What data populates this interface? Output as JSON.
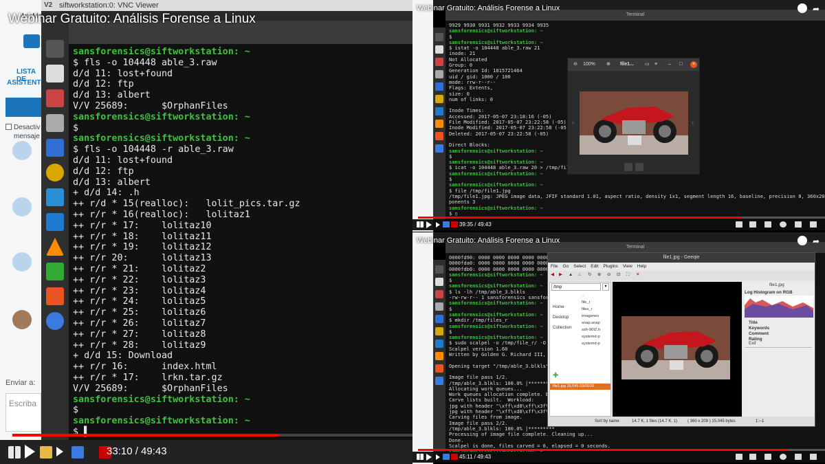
{
  "left": {
    "video_title": "Webinar Gratuito: Análisis Forense a Linux",
    "vnc_title": "siftworkstation:0: VNC Viewer",
    "bg_app": {
      "brand": "AnyMee",
      "list_label": "LISTA DE",
      "list_label2": "ASISTENTES",
      "checkbox_label": "Desactiv",
      "checkbox_label2": "mensaje",
      "send_to": "Enviar a:",
      "compose_placeholder": "Escriba"
    },
    "terminal_lines": [
      {
        "t": "p",
        "text": "sansforensics@siftworkstation: ~"
      },
      {
        "t": "o",
        "text": "$ fls -o 104448 able_3.raw"
      },
      {
        "t": "o",
        "text": "d/d 11: lost+found"
      },
      {
        "t": "o",
        "text": "d/d 12: ftp"
      },
      {
        "t": "o",
        "text": "d/d 13: albert"
      },
      {
        "t": "o",
        "text": "V/V 25689:      $OrphanFiles"
      },
      {
        "t": "p",
        "text": "sansforensics@siftworkstation: ~"
      },
      {
        "t": "o",
        "text": "$"
      },
      {
        "t": "p",
        "text": "sansforensics@siftworkstation: ~"
      },
      {
        "t": "o",
        "text": "$ fls -o 104448 -r able_3.raw"
      },
      {
        "t": "o",
        "text": "d/d 11: lost+found"
      },
      {
        "t": "o",
        "text": "d/d 12: ftp"
      },
      {
        "t": "o",
        "text": "d/d 13: albert"
      },
      {
        "t": "o",
        "text": "+ d/d 14: .h"
      },
      {
        "t": "o",
        "text": "++ r/d * 15(realloc):   lolit_pics.tar.gz"
      },
      {
        "t": "o",
        "text": "++ r/r * 16(realloc):   lolitaz1"
      },
      {
        "t": "o",
        "text": "++ r/r * 17:    lolitaz10"
      },
      {
        "t": "o",
        "text": "++ r/r * 18:    lolitaz11"
      },
      {
        "t": "o",
        "text": "++ r/r * 19:    lolitaz12"
      },
      {
        "t": "o",
        "text": "++ r/r 20:      lolitaz13"
      },
      {
        "t": "o",
        "text": "++ r/r * 21:    lolitaz2"
      },
      {
        "t": "o",
        "text": "++ r/r * 22:    lolitaz3"
      },
      {
        "t": "o",
        "text": "++ r/r * 23:    lolitaz4"
      },
      {
        "t": "o",
        "text": "++ r/r * 24:    lolitaz5"
      },
      {
        "t": "o",
        "text": "++ r/r * 25:    lolitaz6"
      },
      {
        "t": "o",
        "text": "++ r/r * 26:    lolitaz7"
      },
      {
        "t": "o",
        "text": "++ r/r * 27:    lolitaz8"
      },
      {
        "t": "o",
        "text": "++ r/r * 28:    lolitaz9"
      },
      {
        "t": "o",
        "text": "+ d/d 15: Download"
      },
      {
        "t": "o",
        "text": "++ r/r 16:      index.html"
      },
      {
        "t": "o",
        "text": "++ r/r * 17:    lrkn.tar.gz"
      },
      {
        "t": "o",
        "text": "V/V 25689:      $OrphanFiles"
      },
      {
        "t": "p",
        "text": "sansforensics@siftworkstation: ~"
      },
      {
        "t": "o",
        "text": "$"
      },
      {
        "t": "p",
        "text": "sansforensics@siftworkstation: ~"
      },
      {
        "t": "o",
        "text": "$ ▌"
      }
    ],
    "time": "33:10 / 49:43",
    "progress": 0.667
  },
  "top_right": {
    "video_title": "Webinar Gratuito: Análisis Forense a Linux",
    "window_title": "Terminal",
    "terminal_lines": [
      {
        "t": "o",
        "text": "9929 9930 9931 9932 9933 9934 9935"
      },
      {
        "t": "p",
        "text": "sansforensics@siftworkstation: ~"
      },
      {
        "t": "o",
        "text": "$"
      },
      {
        "t": "p",
        "text": "sansforensics@siftworkstation: ~"
      },
      {
        "t": "o",
        "text": "$ istat -o 104448 able_3.raw 21"
      },
      {
        "t": "o",
        "text": "inode: 21"
      },
      {
        "t": "o",
        "text": "Not Allocated"
      },
      {
        "t": "o",
        "text": "Group: 0"
      },
      {
        "t": "o",
        "text": "Generation Id: 1815721464"
      },
      {
        "t": "o",
        "text": "uid / gid: 1000 / 100"
      },
      {
        "t": "o",
        "text": "mode: rrw-r--r--"
      },
      {
        "t": "o",
        "text": "Flags: Extents,"
      },
      {
        "t": "o",
        "text": "size: 0"
      },
      {
        "t": "o",
        "text": "num of links: 0"
      },
      {
        "t": "o",
        "text": ""
      },
      {
        "t": "o",
        "text": "Inode Times:"
      },
      {
        "t": "o",
        "text": "Accessed: 2017-05-07 23:18:16 (-05)"
      },
      {
        "t": "o",
        "text": "File Modified: 2017-05-07 23:22:58 (-05)"
      },
      {
        "t": "o",
        "text": "Inode Modified: 2017-05-07 23:22:58 (-05)"
      },
      {
        "t": "o",
        "text": "Deleted: 2017-05-07 23:22:58 (-05)"
      },
      {
        "t": "o",
        "text": ""
      },
      {
        "t": "o",
        "text": "Direct Blocks:"
      },
      {
        "t": "p",
        "text": "sansforensics@siftworkstation: ~"
      },
      {
        "t": "o",
        "text": "$"
      },
      {
        "t": "p",
        "text": "sansforensics@siftworkstation: ~"
      },
      {
        "t": "o",
        "text": "$ icat -o 104448 able_3.raw 20 > /tmp/file1"
      },
      {
        "t": "p",
        "text": "sansforensics@siftworkstation: ~"
      },
      {
        "t": "o",
        "text": "$"
      },
      {
        "t": "p",
        "text": "sansforensics@siftworkstation: ~"
      },
      {
        "t": "o",
        "text": "$ file /tmp/file1.jpg"
      },
      {
        "t": "o",
        "text": "/tmp/file1.jpg: JPEG image data, JFIF standard 1.01, aspect ratio, density 1x1, segment length 16, baseline, precision 8, 360x209, com"
      },
      {
        "t": "o",
        "text": "ponents 3"
      },
      {
        "t": "p",
        "text": "sansforensics@siftworkstation: ~"
      },
      {
        "t": "o",
        "text": "$ ▯"
      }
    ],
    "viewer": {
      "zoom": "100%",
      "filename": "file1..."
    },
    "time": "39:35 / 49:43",
    "progress": 0.796
  },
  "bottom_right": {
    "video_title": "Webinar Gratuito: Análisis Forense a Linux",
    "window_title": "Terminal",
    "terminal_lines": [
      {
        "t": "o",
        "text": "0000fd90: 0000 0000 0000 0000 0000"
      },
      {
        "t": "o",
        "text": "0000fda0: 0000 0000 0000 0000 0000"
      },
      {
        "t": "o",
        "text": "0000fdb0: 0000 0000 0000 0000 0000"
      },
      {
        "t": "p",
        "text": "sansforensics@siftworkstation: ~"
      },
      {
        "t": "o",
        "text": "$"
      },
      {
        "t": "p",
        "text": "sansforensics@siftworkstation: ~"
      },
      {
        "t": "o",
        "text": "$ ls -lh /tmp/able_3.blkls"
      },
      {
        "t": "o",
        "text": "-rw-rw-r-- 1 sansforensics sansforen"
      },
      {
        "t": "p",
        "text": "sansforensics@siftworkstation: ~"
      },
      {
        "t": "o",
        "text": "$"
      },
      {
        "t": "p",
        "text": "sansforensics@siftworkstation: ~"
      },
      {
        "t": "o",
        "text": "$ mkdir /tmp/files_r"
      },
      {
        "t": "p",
        "text": "sansforensics@siftworkstation: ~"
      },
      {
        "t": "o",
        "text": "$"
      },
      {
        "t": "p",
        "text": "sansforensics@siftworkstation: ~"
      },
      {
        "t": "o",
        "text": "$ sudo scalpel -o /tmp/file_r/ -O /t"
      },
      {
        "t": "o",
        "text": "Scalpel version 1.60"
      },
      {
        "t": "o",
        "text": "Written by Golden G. Richard III, ba"
      },
      {
        "t": "o",
        "text": ""
      },
      {
        "t": "o",
        "text": "Opening target \"/tmp/able_3.blkls\""
      },
      {
        "t": "o",
        "text": ""
      },
      {
        "t": "o",
        "text": "Image file pass 1/2."
      },
      {
        "t": "o",
        "text": "/tmp/able_3.blkls: 100.0% |*********"
      },
      {
        "t": "o",
        "text": "Allocating work queues..."
      },
      {
        "t": "o",
        "text": "Work queues allocation complete. Bui"
      },
      {
        "t": "o",
        "text": "Carve lists built.  Workload:"
      },
      {
        "t": "o",
        "text": "jpg with header \"\\xff\\xd8\\xff\\x3f\\x3"
      },
      {
        "t": "o",
        "text": "jpg with header \"\\xff\\xd8\\xff\\x3f\\x3"
      },
      {
        "t": "o",
        "text": "Carving files from image."
      },
      {
        "t": "o",
        "text": "Image file pass 2/2."
      },
      {
        "t": "o",
        "text": "/tmp/able_3.blkls: 100.0% |*********"
      },
      {
        "t": "o",
        "text": "Processing of image file complete. Cleaning up..."
      },
      {
        "t": "o",
        "text": "Done."
      },
      {
        "t": "o",
        "text": "Scalpel is done, files carved = 6, elapsed = 0 seconds."
      },
      {
        "t": "p",
        "text": "sansforensics@siftworkstation: ~"
      },
      {
        "t": "o",
        "text": "$ ▯"
      }
    ],
    "geeqie": {
      "title": "file1.jpg - Geeqie",
      "menu": [
        "File",
        "Go",
        "Select",
        "Edit",
        "Plugins",
        "View",
        "Help"
      ],
      "path": "/tmp",
      "places": [
        "Home",
        "Desktop",
        "Collection"
      ],
      "files": [
        "..",
        "file_r",
        "files_r",
        "imagenes",
        "snap.snap",
        "ssh-90IZ.h",
        "systemd-p",
        "systemd-p"
      ],
      "selected_file": "file1.jpg   15,045   03/03/20",
      "info_filename": "file1.jpg",
      "histogram_label": "Log Histogram on RGB",
      "props": [
        "Title",
        "Keywords",
        "Comment",
        "Rating"
      ],
      "exif": "Exif",
      "status_sort": "Sort by name",
      "status_count": "14.7 K, 1 files (14.7 K, 1)",
      "status_dims": "( 360 x 209 ) 15,045 bytes",
      "status_zoom": "1:--1"
    },
    "time": "45:11 / 49:43",
    "progress": 0.909
  },
  "colors": {
    "prompt": "#3ec13e",
    "youtube_red": "#ff0000",
    "terminal_bg": "#111111"
  }
}
